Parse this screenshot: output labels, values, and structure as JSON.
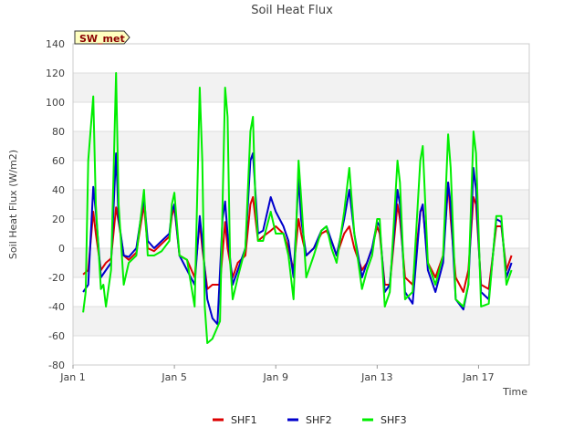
{
  "chart_data": {
    "type": "line",
    "title": "Soil Heat Flux",
    "xlabel": "Time",
    "ylabel": "Soil Heat Flux (W/m2)",
    "badge": "SW_met",
    "ylim": [
      -80,
      140
    ],
    "xlim": [
      0,
      18
    ],
    "yticks": [
      -80,
      -60,
      -40,
      -20,
      0,
      20,
      40,
      60,
      80,
      100,
      120,
      140
    ],
    "xticks": [
      {
        "x": 0,
        "label": "Jan 1"
      },
      {
        "x": 4,
        "label": "Jan 5"
      },
      {
        "x": 8,
        "label": "Jan 9"
      },
      {
        "x": 12,
        "label": "Jan 13"
      },
      {
        "x": 16,
        "label": "Jan 17"
      }
    ],
    "grid": true,
    "legend_position": "bottom-center",
    "series": [
      {
        "name": "SHF1",
        "color": "#dd0000",
        "points": [
          [
            0.4,
            -18
          ],
          [
            0.6,
            -15
          ],
          [
            0.8,
            25
          ],
          [
            0.9,
            10
          ],
          [
            1.1,
            -15
          ],
          [
            1.3,
            -10
          ],
          [
            1.5,
            -7
          ],
          [
            1.7,
            28
          ],
          [
            1.8,
            18
          ],
          [
            2.0,
            -5
          ],
          [
            2.2,
            -8
          ],
          [
            2.5,
            -3
          ],
          [
            2.8,
            30
          ],
          [
            2.95,
            0
          ],
          [
            3.2,
            -2
          ],
          [
            3.5,
            3
          ],
          [
            3.8,
            8
          ],
          [
            3.9,
            22
          ],
          [
            4.0,
            28
          ],
          [
            4.2,
            -5
          ],
          [
            4.5,
            -8
          ],
          [
            4.8,
            -20
          ],
          [
            5.0,
            18
          ],
          [
            5.1,
            0
          ],
          [
            5.3,
            -28
          ],
          [
            5.5,
            -25
          ],
          [
            5.8,
            -25
          ],
          [
            6.0,
            18
          ],
          [
            6.1,
            0
          ],
          [
            6.3,
            -20
          ],
          [
            6.5,
            -10
          ],
          [
            6.8,
            -5
          ],
          [
            7.0,
            30
          ],
          [
            7.1,
            35
          ],
          [
            7.3,
            5
          ],
          [
            7.5,
            8
          ],
          [
            7.8,
            12
          ],
          [
            8.0,
            15
          ],
          [
            8.3,
            10
          ],
          [
            8.5,
            0
          ],
          [
            8.7,
            -15
          ],
          [
            8.9,
            20
          ],
          [
            9.0,
            10
          ],
          [
            9.2,
            -5
          ],
          [
            9.5,
            0
          ],
          [
            9.8,
            10
          ],
          [
            10.0,
            12
          ],
          [
            10.2,
            5
          ],
          [
            10.4,
            -5
          ],
          [
            10.7,
            10
          ],
          [
            10.9,
            15
          ],
          [
            11.1,
            0
          ],
          [
            11.4,
            -15
          ],
          [
            11.6,
            -10
          ],
          [
            11.8,
            0
          ],
          [
            12.0,
            15
          ],
          [
            12.1,
            10
          ],
          [
            12.3,
            -25
          ],
          [
            12.5,
            -25
          ],
          [
            12.8,
            30
          ],
          [
            12.9,
            20
          ],
          [
            13.1,
            -20
          ],
          [
            13.4,
            -25
          ],
          [
            13.7,
            25
          ],
          [
            13.8,
            28
          ],
          [
            14.0,
            -10
          ],
          [
            14.3,
            -20
          ],
          [
            14.6,
            -5
          ],
          [
            14.8,
            45
          ],
          [
            14.9,
            20
          ],
          [
            15.1,
            -20
          ],
          [
            15.4,
            -30
          ],
          [
            15.6,
            -15
          ],
          [
            15.8,
            35
          ],
          [
            15.9,
            30
          ],
          [
            16.1,
            -25
          ],
          [
            16.4,
            -28
          ],
          [
            16.7,
            15
          ],
          [
            16.9,
            15
          ],
          [
            17.1,
            -15
          ],
          [
            17.3,
            -5
          ]
        ]
      },
      {
        "name": "SHF2",
        "color": "#0000cc",
        "points": [
          [
            0.4,
            -30
          ],
          [
            0.6,
            -25
          ],
          [
            0.8,
            42
          ],
          [
            0.9,
            25
          ],
          [
            1.1,
            -20
          ],
          [
            1.3,
            -15
          ],
          [
            1.5,
            -10
          ],
          [
            1.7,
            65
          ],
          [
            1.8,
            20
          ],
          [
            2.0,
            -5
          ],
          [
            2.2,
            -6
          ],
          [
            2.5,
            0
          ],
          [
            2.8,
            35
          ],
          [
            2.95,
            5
          ],
          [
            3.2,
            0
          ],
          [
            3.5,
            5
          ],
          [
            3.8,
            10
          ],
          [
            3.9,
            25
          ],
          [
            4.0,
            30
          ],
          [
            4.2,
            -5
          ],
          [
            4.5,
            -15
          ],
          [
            4.8,
            -25
          ],
          [
            5.0,
            22
          ],
          [
            5.1,
            5
          ],
          [
            5.3,
            -35
          ],
          [
            5.5,
            -48
          ],
          [
            5.7,
            -52
          ],
          [
            5.9,
            20
          ],
          [
            6.0,
            32
          ],
          [
            6.1,
            10
          ],
          [
            6.3,
            -25
          ],
          [
            6.5,
            -15
          ],
          [
            6.8,
            0
          ],
          [
            7.0,
            60
          ],
          [
            7.1,
            65
          ],
          [
            7.3,
            10
          ],
          [
            7.5,
            12
          ],
          [
            7.8,
            35
          ],
          [
            8.0,
            25
          ],
          [
            8.3,
            15
          ],
          [
            8.5,
            5
          ],
          [
            8.7,
            -20
          ],
          [
            8.9,
            48
          ],
          [
            9.0,
            20
          ],
          [
            9.2,
            -5
          ],
          [
            9.5,
            0
          ],
          [
            9.8,
            12
          ],
          [
            10.0,
            15
          ],
          [
            10.2,
            5
          ],
          [
            10.4,
            -5
          ],
          [
            10.7,
            20
          ],
          [
            10.9,
            40
          ],
          [
            11.1,
            10
          ],
          [
            11.4,
            -20
          ],
          [
            11.6,
            -10
          ],
          [
            11.8,
            0
          ],
          [
            12.0,
            18
          ],
          [
            12.1,
            15
          ],
          [
            12.3,
            -30
          ],
          [
            12.5,
            -25
          ],
          [
            12.8,
            40
          ],
          [
            12.9,
            30
          ],
          [
            13.1,
            -30
          ],
          [
            13.4,
            -38
          ],
          [
            13.7,
            25
          ],
          [
            13.8,
            30
          ],
          [
            14.0,
            -15
          ],
          [
            14.3,
            -30
          ],
          [
            14.6,
            -10
          ],
          [
            14.8,
            45
          ],
          [
            14.9,
            30
          ],
          [
            15.1,
            -35
          ],
          [
            15.4,
            -42
          ],
          [
            15.6,
            -25
          ],
          [
            15.8,
            55
          ],
          [
            15.9,
            40
          ],
          [
            16.1,
            -30
          ],
          [
            16.4,
            -35
          ],
          [
            16.7,
            20
          ],
          [
            16.9,
            18
          ],
          [
            17.1,
            -20
          ],
          [
            17.3,
            -10
          ]
        ]
      },
      {
        "name": "SHF3",
        "color": "#00ee00",
        "points": [
          [
            0.4,
            -44
          ],
          [
            0.5,
            -30
          ],
          [
            0.6,
            60
          ],
          [
            0.8,
            104
          ],
          [
            0.9,
            30
          ],
          [
            1.1,
            -28
          ],
          [
            1.2,
            -25
          ],
          [
            1.3,
            -40
          ],
          [
            1.5,
            -15
          ],
          [
            1.6,
            50
          ],
          [
            1.7,
            120
          ],
          [
            1.8,
            30
          ],
          [
            2.0,
            -25
          ],
          [
            2.2,
            -10
          ],
          [
            2.5,
            -5
          ],
          [
            2.8,
            40
          ],
          [
            2.95,
            -5
          ],
          [
            3.2,
            -5
          ],
          [
            3.5,
            -2
          ],
          [
            3.8,
            5
          ],
          [
            3.9,
            30
          ],
          [
            4.0,
            38
          ],
          [
            4.2,
            -5
          ],
          [
            4.5,
            -8
          ],
          [
            4.8,
            -40
          ],
          [
            5.0,
            110
          ],
          [
            5.1,
            60
          ],
          [
            5.2,
            -40
          ],
          [
            5.3,
            -65
          ],
          [
            5.5,
            -62
          ],
          [
            5.8,
            -50
          ],
          [
            6.0,
            110
          ],
          [
            6.1,
            90
          ],
          [
            6.2,
            -10
          ],
          [
            6.3,
            -35
          ],
          [
            6.5,
            -20
          ],
          [
            6.8,
            0
          ],
          [
            7.0,
            80
          ],
          [
            7.1,
            90
          ],
          [
            7.2,
            30
          ],
          [
            7.3,
            5
          ],
          [
            7.5,
            5
          ],
          [
            7.8,
            25
          ],
          [
            8.0,
            10
          ],
          [
            8.3,
            10
          ],
          [
            8.5,
            -5
          ],
          [
            8.7,
            -35
          ],
          [
            8.9,
            60
          ],
          [
            9.0,
            35
          ],
          [
            9.2,
            -20
          ],
          [
            9.5,
            -5
          ],
          [
            9.8,
            12
          ],
          [
            10.0,
            15
          ],
          [
            10.2,
            0
          ],
          [
            10.4,
            -10
          ],
          [
            10.7,
            25
          ],
          [
            10.9,
            55
          ],
          [
            11.1,
            10
          ],
          [
            11.4,
            -28
          ],
          [
            11.6,
            -15
          ],
          [
            11.8,
            -5
          ],
          [
            12.0,
            20
          ],
          [
            12.1,
            20
          ],
          [
            12.3,
            -40
          ],
          [
            12.5,
            -30
          ],
          [
            12.8,
            60
          ],
          [
            12.9,
            45
          ],
          [
            13.1,
            -35
          ],
          [
            13.4,
            -30
          ],
          [
            13.7,
            60
          ],
          [
            13.8,
            70
          ],
          [
            14.0,
            -10
          ],
          [
            14.3,
            -25
          ],
          [
            14.6,
            -5
          ],
          [
            14.8,
            78
          ],
          [
            14.9,
            55
          ],
          [
            15.1,
            -35
          ],
          [
            15.4,
            -40
          ],
          [
            15.6,
            -25
          ],
          [
            15.8,
            80
          ],
          [
            15.9,
            65
          ],
          [
            16.1,
            -40
          ],
          [
            16.4,
            -38
          ],
          [
            16.7,
            22
          ],
          [
            16.9,
            22
          ],
          [
            17.1,
            -25
          ],
          [
            17.3,
            -15
          ]
        ]
      }
    ]
  }
}
